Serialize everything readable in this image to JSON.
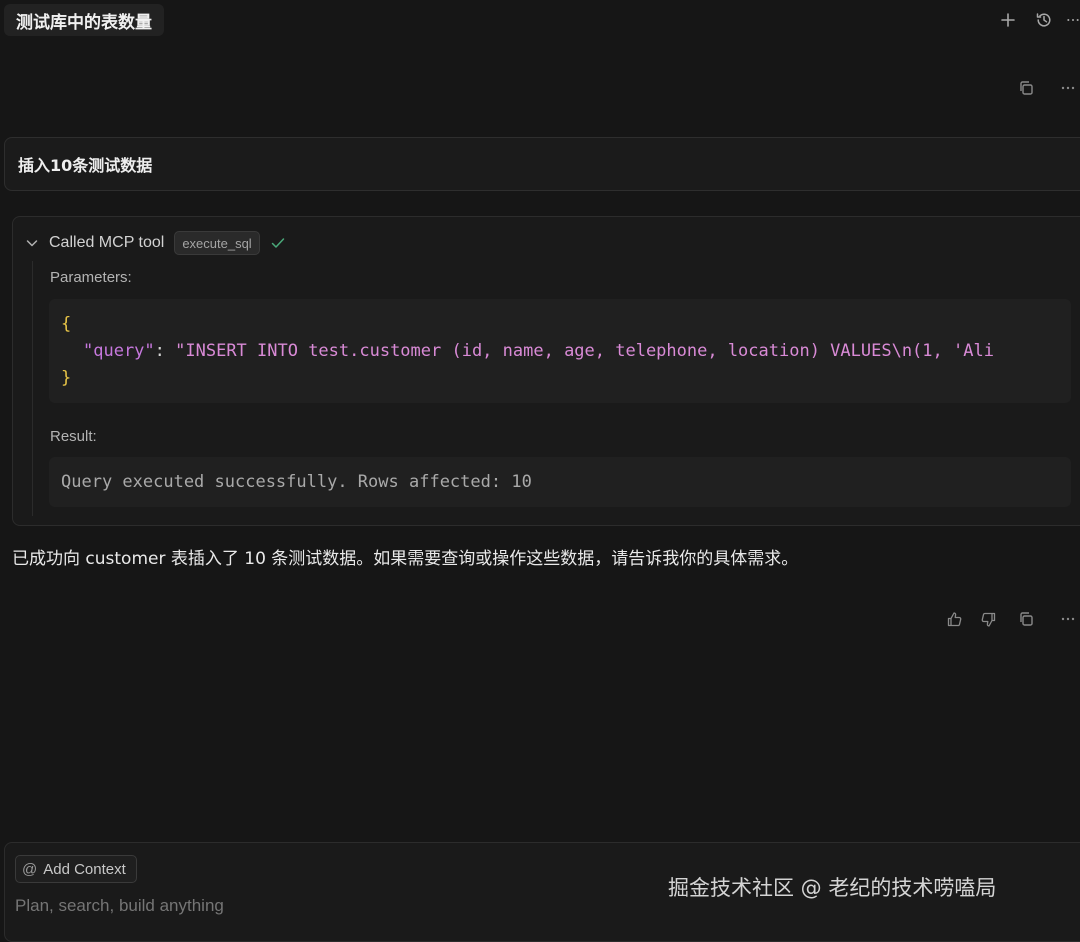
{
  "header": {
    "tab_title": "测试库中的表数量",
    "icons": [
      "plus-icon",
      "history-icon",
      "more-icon"
    ]
  },
  "user_message": {
    "text": "插入10条测试数据"
  },
  "tool_call": {
    "label": "Called MCP tool",
    "tool_name": "execute_sql",
    "status": "success",
    "parameters_label": "Parameters:",
    "code": {
      "open_brace": "{",
      "key": "\"query\"",
      "colon": ": ",
      "value": "\"INSERT INTO test.customer (id, name, age, telephone, location) VALUES\\n(1, 'Ali",
      "close_brace": "}"
    },
    "result_label": "Result:",
    "result": "Query executed successfully. Rows affected: 10"
  },
  "assistant_reply": {
    "text": "已成功向 customer 表插入了 10 条测试数据。如果需要查询或操作这些数据，请告诉我你的具体需求。"
  },
  "composer": {
    "context_button": "Add Context",
    "placeholder": "Plan, search, build anything"
  },
  "watermark": "掘金技术社区 @ 老纪的技术唠嗑局",
  "colors": {
    "background": "#161616",
    "success_check": "#4aa97a",
    "json_brace": "#e8c547",
    "json_key": "#c678dd",
    "json_string": "#d98ad6"
  }
}
